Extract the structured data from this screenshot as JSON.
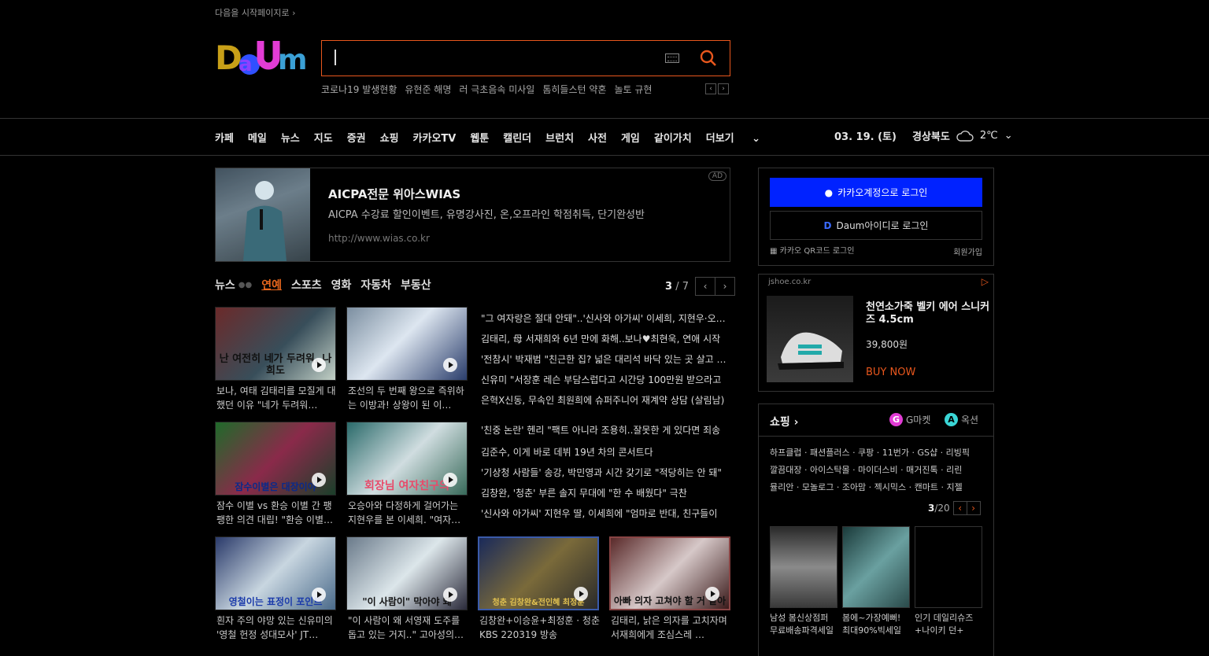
{
  "top": {
    "start_page_text": "다음을 시작페이지로 ›"
  },
  "logo": {
    "text": "Daum"
  },
  "search": {
    "placeholder": "",
    "value": ""
  },
  "trending": [
    "코로나19 발생현황",
    "유현준 해명",
    "러 극초음속 미사일",
    "톰히들스턴 약혼",
    "놀토 규현"
  ],
  "nav": {
    "items": [
      "카페",
      "메일",
      "뉴스",
      "지도",
      "증권",
      "쇼핑",
      "카카오TV",
      "웹툰",
      "캘린더",
      "브런치",
      "사전",
      "게임",
      "같이가치",
      "더보기"
    ],
    "date": "03. 19. (토)",
    "location": "경상북도",
    "temperature": "2℃"
  },
  "ad": {
    "title": "AICPA전문 위아스WIAS",
    "description": "AICPA 수강료 할인이벤트, 유명강사진, 온,오프라인 학점취득, 단기완성반",
    "url": "http://www.wias.co.kr",
    "badge": "AD"
  },
  "news_tabs": {
    "items": [
      "뉴스",
      "연예",
      "스포츠",
      "영화",
      "자동차",
      "부동산"
    ],
    "active": "연예",
    "page": "3",
    "total": "/ 7"
  },
  "thumbnails": [
    {
      "caption_overlay": "난 여전히 네가 두려워, 나희도",
      "title": "보나, 여태 김태리를 모질게 대했던 이유 \"네가 두려워…"
    },
    {
      "caption_overlay": "",
      "title": "조선의 두 번째 왕으로 즉위하는 이방과! 상왕이 된 이…"
    },
    {
      "caption_overlay": "잠수이별은 대장이야",
      "title": "잠수 이별 vs 환승 이별 간 팽팽한 의견 대립! \"환승 이별…"
    },
    {
      "caption_overlay": "회장님 여자친구의",
      "title": "오승아와 다정하게 걸어가는 지현우를 본 이세희. \"여자…"
    },
    {
      "caption_overlay": "영철이는 표정이 포인트",
      "title": "흰자 주의 야망 있는 신유미의 '영철 헌정 성대모사' JT…"
    },
    {
      "caption_overlay": "\"이 사람이\" 막아야 돼",
      "title": "\"이 사람이 왜 서영재 도주를 돕고 있는 거지..\" 고아성의…"
    },
    {
      "caption_overlay": "청춘 김창완&전인혜 최정훈",
      "title": "김창완+이승윤+최정훈 · 청춘 KBS 220319 방송"
    },
    {
      "caption_overlay": "아빠 의자 고쳐야 할 거 같아",
      "title": "김태리, 낡은 의자를 고치자며 서재희에게 조심스레 …"
    }
  ],
  "headlines_group1": [
    "\"그 여자랑은 절대 안돼\"..'신사와 아가씨' 이세희, 지현우·오승아",
    "김태리, 母 서재희와 6년 만에 화해..보나♥최현욱, 연애 시작",
    "'전참시' 박재범 \"친근한 집? 넓은 대리석 바닥 있는 곳 살고 싶어",
    "신유미 \"서장훈 레슨 부담스럽다고 시간당 100만원 받으라고",
    "은혁X신동, 무속인 최원희에 슈퍼주니어 재계약 상담 (살림남)"
  ],
  "headlines_group2": [
    "'친중 논란' 헨리 \"팩트 아니라 조용히..잘못한 게 있다면 죄송",
    "김준수, 이게 바로 데뷔 19년 차의 콘서트다",
    "'기상청 사람들' 송강, 박민영과 시간 갖기로 \"적당히는 안 돼\"",
    "김창완, '청춘' 부른 솔지 무대에 \"한 수 배웠다\" 극찬",
    "'신사와 아가씨' 지현우 딸, 이세희에 \"엄마로 반대, 친구들이"
  ],
  "login": {
    "kakao": "카카오계정으로 로그인",
    "daum": "Daum아이디로 로그인",
    "qr": "카카오 QR코드 로그인",
    "join": "회원가입"
  },
  "side_ad": {
    "domain": "jshoe.co.kr",
    "title": "천연소가죽 벨키 에어 스니커즈 4.5cm",
    "price": "39,800원",
    "cta": "BUY NOW"
  },
  "shopping": {
    "title": "쇼핑 ›",
    "partner1": "G마켓",
    "partner2": "옥션",
    "links_line1": "하프클럽 · 패션플러스 · 쿠팡 · 11번가 · GS샵 · 리빙픽",
    "links_line2": "깔끔대장 · 아이스탁몰 · 마이더스비 · 매거진톡 · 리린",
    "links_line3": "뮬리안 · 모놀로그 · 조아맘 · 젝시믹스 · 캔마트 · 지젤",
    "page": "3",
    "total": "/20",
    "items": [
      {
        "line1": "남성 봄신상점퍼",
        "line2": "무료배송파격세일"
      },
      {
        "line1": "봄에~가장예뻐!",
        "line2": "최대90%빅세일"
      },
      {
        "line1": "인기 데일리슈즈",
        "line2": "+나이키 던+"
      }
    ]
  },
  "colors": {
    "accent": "#e8571d",
    "kakao_blue": "#0022ff",
    "background": "#000000"
  }
}
